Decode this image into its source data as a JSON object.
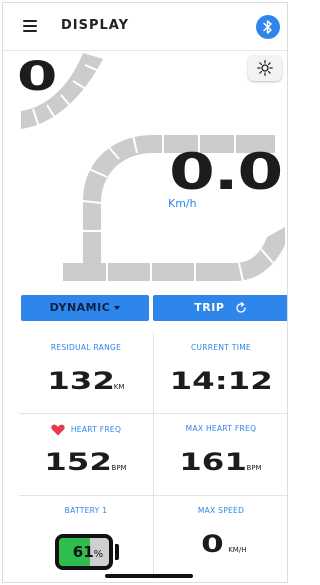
{
  "header": {
    "title": "DISPLAY",
    "menu_icon": "hamburger-menu-icon",
    "bluetooth_icon": "bluetooth-icon",
    "bluetooth_color": "#2f86ea"
  },
  "dashboard": {
    "assist_level": "0",
    "speed": "0.0",
    "speed_unit": "Km/h",
    "light_icon": "sun-brightness-icon"
  },
  "modes": {
    "dynamic_label": "DYNAMIC",
    "trip_label": "TRIP",
    "accent": "#2f86ea"
  },
  "stats": {
    "residual_range": {
      "label": "RESIDUAL RANGE",
      "value": "132",
      "unit": "KM"
    },
    "current_time": {
      "label": "CURRENT TIME",
      "value": "14:12"
    },
    "heart_freq": {
      "label": "HEART FREQ",
      "value": "152",
      "unit": "BPM",
      "icon": "heart-icon",
      "icon_color": "#e53950"
    },
    "max_heart_freq": {
      "label": "MAX HEART FREQ",
      "value": "161",
      "unit": "BPM"
    },
    "battery": {
      "label": "BATTERY 1",
      "value": "61",
      "unit": "%",
      "level": 0.61,
      "fill_color": "#2ebd4f"
    },
    "max_speed": {
      "label": "MAX SPEED",
      "value": "0",
      "unit": "KM/H"
    }
  }
}
